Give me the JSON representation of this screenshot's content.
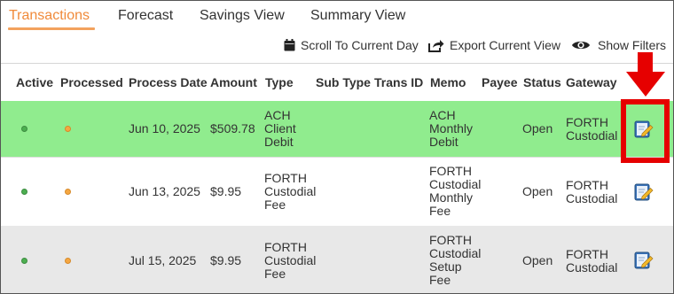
{
  "tabs": [
    {
      "label": "Transactions",
      "active": true
    },
    {
      "label": "Forecast",
      "active": false
    },
    {
      "label": "Savings View",
      "active": false
    },
    {
      "label": "Summary View",
      "active": false
    }
  ],
  "toolbar": {
    "scroll_label": "Scroll To Current Day",
    "export_label": "Export Current View",
    "filters_label": "Show Filters"
  },
  "columns": [
    "Active",
    "Processed",
    "Process Date",
    "Amount",
    "Type",
    "Sub Type",
    "Trans ID",
    "Memo",
    "Payee",
    "Status",
    "Gateway"
  ],
  "rows": [
    {
      "process_date": "Jun 10, 2025",
      "amount": "$509.78",
      "type": "ACH Client Debit",
      "type_lines": [
        "ACH",
        "Client",
        "Debit"
      ],
      "sub_type": "",
      "trans_id": "",
      "memo": "ACH Monthly Debit",
      "memo_lines": [
        "ACH",
        "Monthly",
        "Debit"
      ],
      "payee": "",
      "status": "Open",
      "gateway": "FORTH Custodial",
      "gateway_lines": [
        "FORTH",
        "Custodial"
      ],
      "highlighted": true
    },
    {
      "process_date": "Jun 13, 2025",
      "amount": "$9.95",
      "type": "FORTH Custodial Fee",
      "type_lines": [
        "FORTH",
        "Custodial",
        "Fee"
      ],
      "sub_type": "",
      "trans_id": "",
      "memo": "FORTH Custodial Monthly Fee",
      "memo_lines": [
        "FORTH",
        "Custodial",
        "Monthly",
        "Fee"
      ],
      "payee": "",
      "status": "Open",
      "gateway": "FORTH Custodial",
      "gateway_lines": [
        "FORTH",
        "Custodial"
      ],
      "highlighted": false
    },
    {
      "process_date": "Jul 15, 2025",
      "amount": "$9.95",
      "type": "FORTH Custodial Fee",
      "type_lines": [
        "FORTH",
        "Custodial",
        "Fee"
      ],
      "sub_type": "",
      "trans_id": "",
      "memo": "FORTH Custodial Setup Fee",
      "memo_lines": [
        "FORTH",
        "Custodial",
        "Setup",
        "Fee"
      ],
      "payee": "",
      "status": "Open",
      "gateway": "FORTH Custodial",
      "gateway_lines": [
        "FORTH",
        "Custodial"
      ],
      "highlighted": false
    }
  ],
  "colors": {
    "active_tab": "#f08a3a",
    "highlight_row": "#90ec8e",
    "annotation_red": "#e60000",
    "active_dot": "#4caf50",
    "processed_dot": "#f5a742"
  },
  "icons": {
    "scroll": "calendar-icon",
    "export": "export-icon",
    "filters": "eye-icon",
    "row_action": "edit-icon"
  }
}
